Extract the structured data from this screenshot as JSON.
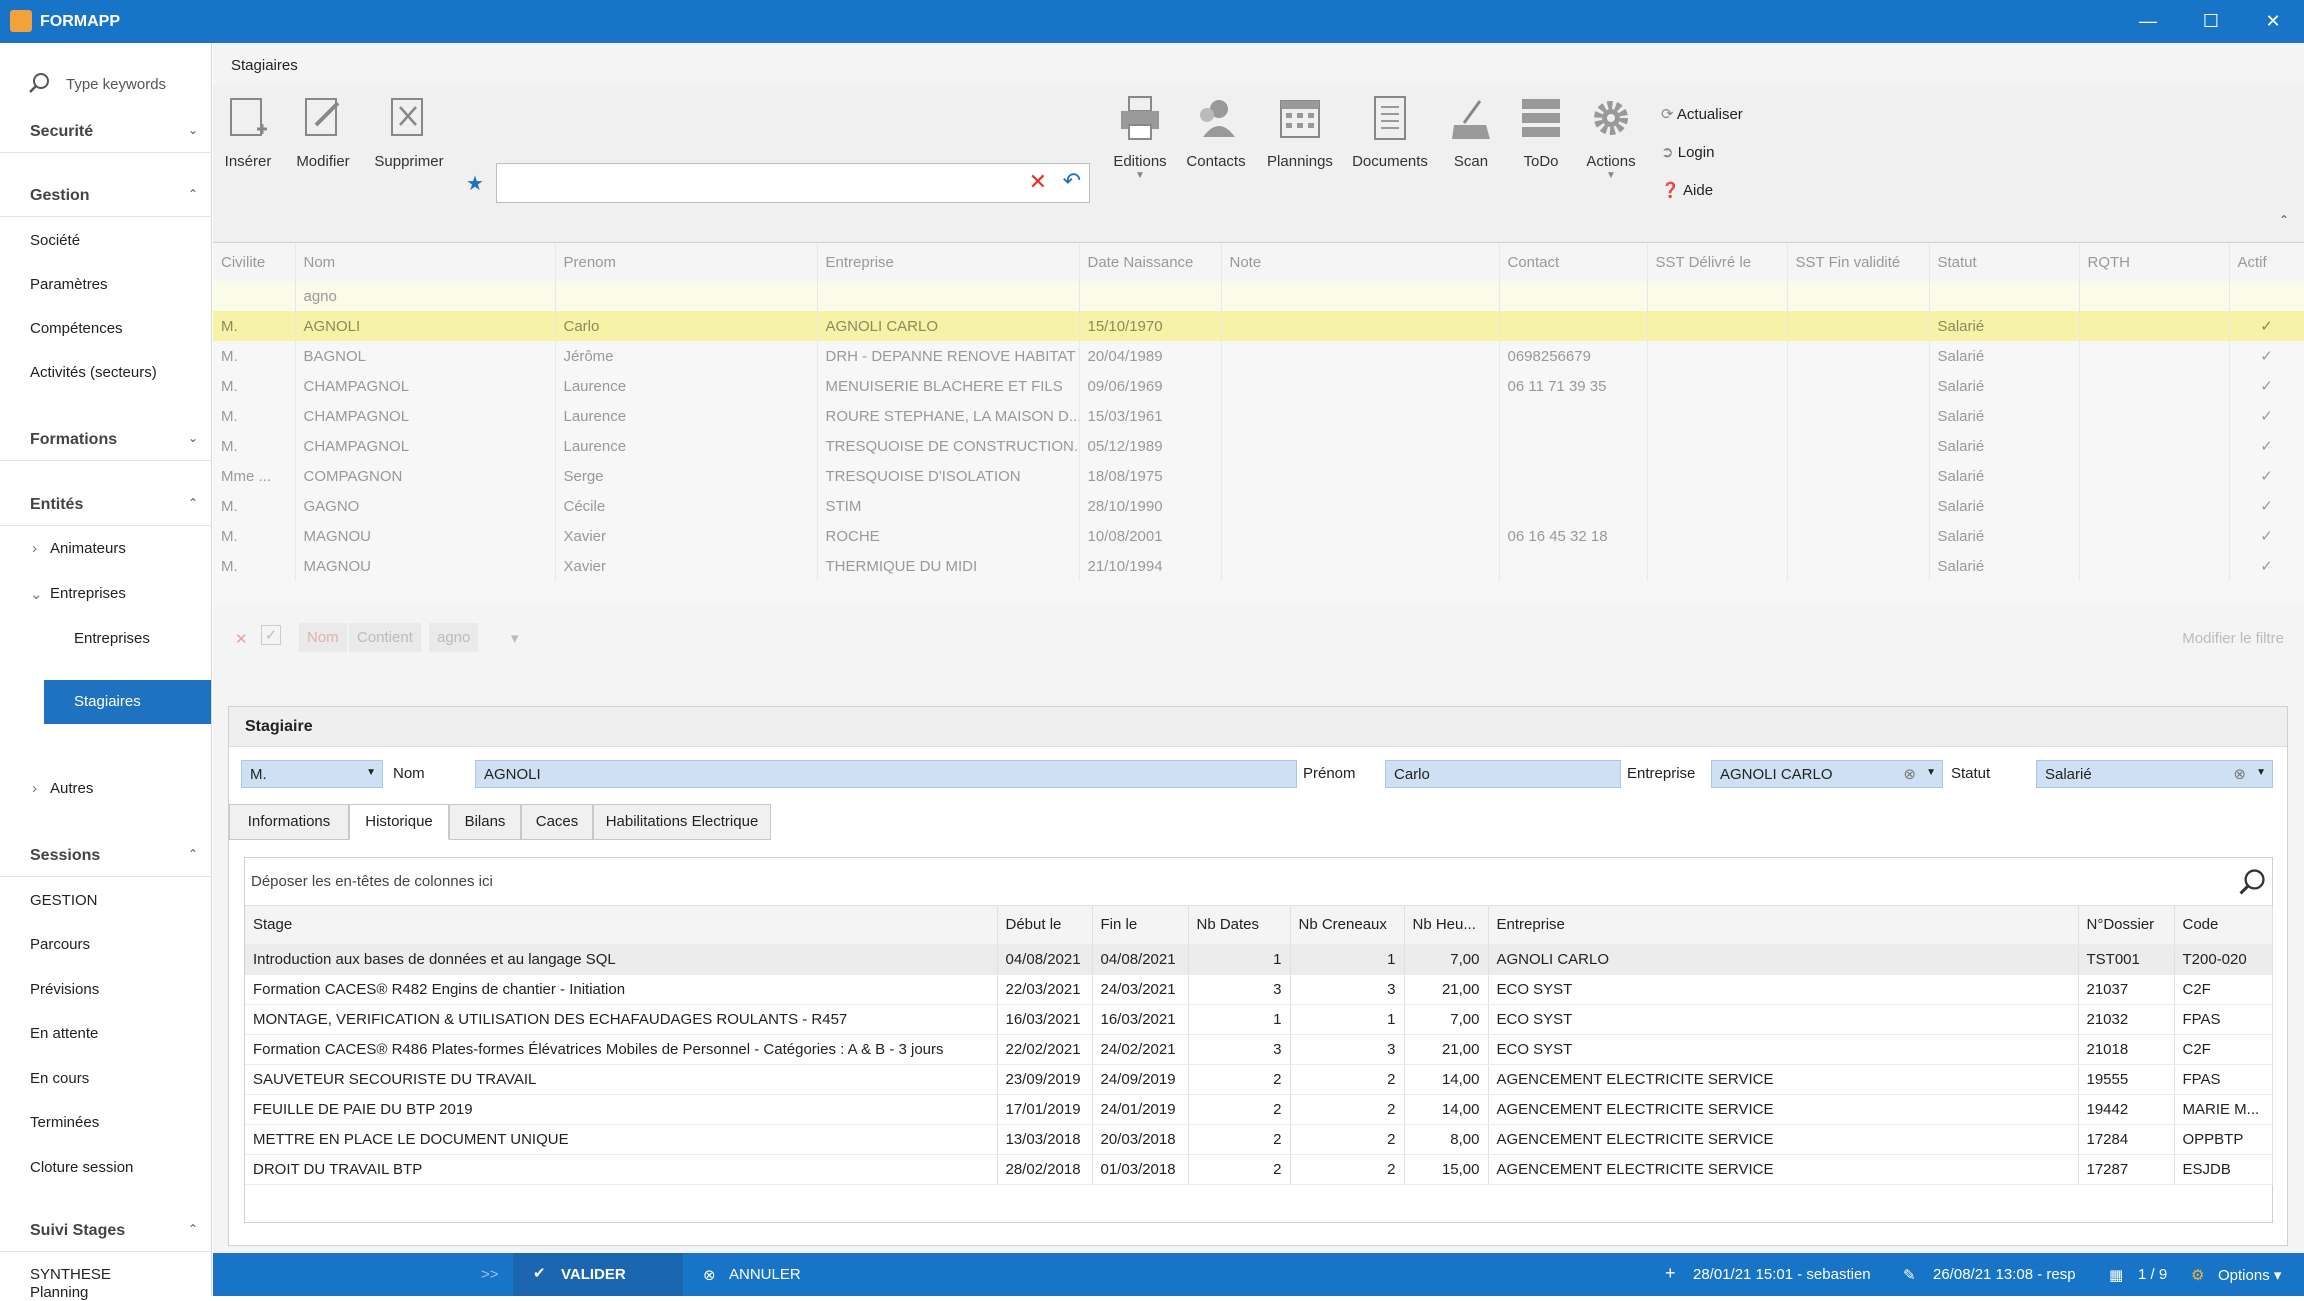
{
  "app": {
    "title": "FORMAPP"
  },
  "sidebar": {
    "search_placeholder": "Type keywords",
    "sections": [
      {
        "label": "Securité"
      },
      {
        "label": "Gestion",
        "items": [
          "Société",
          "Paramètres",
          "Compétences",
          "Activités (secteurs)"
        ]
      },
      {
        "label": "Formations"
      },
      {
        "label": "Entités",
        "items": [
          "Animateurs",
          "Entreprises",
          "Entreprises",
          "Stagiaires",
          "Autres"
        ]
      },
      {
        "label": "Sessions",
        "items": [
          "GESTION",
          "Parcours",
          "Prévisions",
          "En attente",
          "En cours",
          "Terminées",
          "Cloture session"
        ]
      },
      {
        "label": "Suivi Stages",
        "items": [
          "SYNTHESE",
          "Planning"
        ]
      }
    ]
  },
  "main": {
    "title": "Stagiaires",
    "ribbon": {
      "insert": "Insérer",
      "modify": "Modifier",
      "delete": "Supprimer",
      "editions": "Editions",
      "contacts": "Contacts",
      "plannings": "Plannings",
      "documents": "Documents",
      "scan": "Scan",
      "todo": "ToDo",
      "actions": "Actions",
      "refresh": "Actualiser",
      "login": "Login",
      "help": "Aide"
    },
    "grid": {
      "columns": [
        "Civilite",
        "Nom",
        "Prenom",
        "Entreprise",
        "Date Naissance",
        "Note",
        "Contact",
        "SST Délivré le",
        "SST Fin validité",
        "Statut",
        "RQTH",
        "Actif"
      ],
      "filter_value": "agno",
      "rows": [
        [
          "M.",
          "AGNOLI",
          "Carlo",
          "AGNOLI CARLO",
          "15/10/1970",
          "",
          "",
          "",
          "",
          "Salarié",
          "",
          "✓"
        ],
        [
          "M.",
          "BAGNOL",
          "Jérôme",
          "DRH - DEPANNE RENOVE HABITAT",
          "20/04/1989",
          "",
          "0698256679",
          "",
          "",
          "Salarié",
          "",
          "✓"
        ],
        [
          "M.",
          "CHAMPAGNOL",
          "Laurence",
          "MENUISERIE BLACHERE ET FILS",
          "09/06/1969",
          "",
          "06 11 71 39 35",
          "",
          "",
          "Salarié",
          "",
          "✓"
        ],
        [
          "M.",
          "CHAMPAGNOL",
          "Laurence",
          "ROURE STEPHANE, LA MAISON D...",
          "15/03/1961",
          "",
          "",
          "",
          "",
          "Salarié",
          "",
          "✓"
        ],
        [
          "M.",
          "CHAMPAGNOL",
          "Laurence",
          "TRESQUOISE DE CONSTRUCTION...",
          "05/12/1989",
          "",
          "",
          "",
          "",
          "Salarié",
          "",
          "✓"
        ],
        [
          "Mme ...",
          "COMPAGNON",
          "Serge",
          "TRESQUOISE D'ISOLATION",
          "18/08/1975",
          "",
          "",
          "",
          "",
          "Salarié",
          "",
          "✓"
        ],
        [
          "M.",
          "GAGNO",
          "Cécile",
          "STIM",
          "28/10/1990",
          "",
          "",
          "",
          "",
          "Salarié",
          "",
          "✓"
        ],
        [
          "M.",
          "MAGNOU",
          "Xavier",
          "ROCHE",
          "10/08/2001",
          "",
          "06 16 45 32 18",
          "",
          "",
          "Salarié",
          "",
          "✓"
        ],
        [
          "M.",
          "MAGNOU",
          "Xavier",
          "THERMIQUE DU MIDI",
          "21/10/1994",
          "",
          "",
          "",
          "",
          "Salarié",
          "",
          "✓"
        ]
      ],
      "filter_bar": {
        "field": "Nom",
        "op": "Contient",
        "value": "agno",
        "edit": "Modifier le filtre"
      }
    },
    "detail": {
      "title": "Stagiaire",
      "civilite": "M.",
      "nom_label": "Nom",
      "nom": "AGNOLI",
      "prenom_label": "Prénom",
      "prenom": "Carlo",
      "entreprise_label": "Entreprise",
      "entreprise": "AGNOLI CARLO",
      "statut_label": "Statut",
      "statut": "Salarié",
      "tabs": [
        "Informations",
        "Historique",
        "Bilans",
        "Caces",
        "Habilitations Electrique"
      ],
      "group_hint": "Déposer les en-têtes de colonnes ici",
      "hist_columns": [
        "Stage",
        "Début le",
        "Fin le",
        "Nb Dates",
        "Nb Creneaux",
        "Nb Heu...",
        "Entreprise",
        "N°Dossier",
        "Code"
      ],
      "hist_rows": [
        [
          "Introduction aux bases de données et au langage SQL",
          "04/08/2021",
          "04/08/2021",
          "1",
          "1",
          "7,00",
          "AGNOLI CARLO",
          "TST001",
          "T200-020"
        ],
        [
          "Formation CACES® R482 Engins de chantier - Initiation",
          "22/03/2021",
          "24/03/2021",
          "3",
          "3",
          "21,00",
          "ECO SYST",
          "21037",
          "C2F"
        ],
        [
          "MONTAGE, VERIFICATION & UTILISATION DES ECHAFAUDAGES ROULANTS - R457",
          "16/03/2021",
          "16/03/2021",
          "1",
          "1",
          "7,00",
          "ECO SYST",
          "21032",
          "FPAS"
        ],
        [
          "Formation CACES® R486 Plates-formes Élévatrices Mobiles de Personnel - Catégories : A & B - 3 jours",
          "22/02/2021",
          "24/02/2021",
          "3",
          "3",
          "21,00",
          "ECO SYST",
          "21018",
          "C2F"
        ],
        [
          "SAUVETEUR SECOURISTE DU TRAVAIL",
          "23/09/2019",
          "24/09/2019",
          "2",
          "2",
          "14,00",
          "AGENCEMENT ELECTRICITE SERVICE",
          "19555",
          "FPAS"
        ],
        [
          "FEUILLE DE PAIE DU BTP 2019",
          "17/01/2019",
          "24/01/2019",
          "2",
          "2",
          "14,00",
          "AGENCEMENT ELECTRICITE SERVICE",
          "19442",
          "MARIE M..."
        ],
        [
          "METTRE EN PLACE LE DOCUMENT UNIQUE",
          "13/03/2018",
          "20/03/2018",
          "2",
          "2",
          "8,00",
          "AGENCEMENT ELECTRICITE SERVICE",
          "17284",
          "OPPBTP"
        ],
        [
          "DROIT DU TRAVAIL BTP",
          "28/02/2018",
          "01/03/2018",
          "2",
          "2",
          "15,00",
          "AGENCEMENT ELECTRICITE SERVICE",
          "17287",
          "ESJDB"
        ]
      ]
    }
  },
  "status": {
    "arrows": ">>",
    "validate": "VALIDER",
    "cancel": "ANNULER",
    "created": "28/01/21 15:01 - sebastien",
    "modified": "26/08/21 13:08 - resp",
    "page": "1 / 9",
    "options": "Options"
  }
}
